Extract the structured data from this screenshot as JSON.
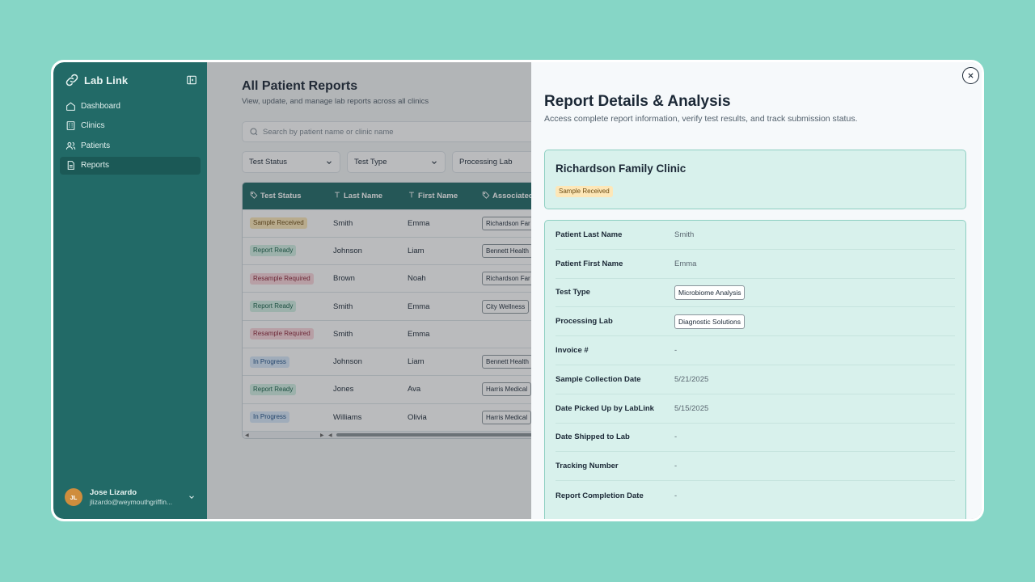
{
  "colors": {
    "brand": "#226a67",
    "background": "#86d6c6",
    "card": "#d8f1ec"
  },
  "sidebar": {
    "app_name": "Lab Link",
    "nav": [
      {
        "label": "Dashboard",
        "icon": "home-icon"
      },
      {
        "label": "Clinics",
        "icon": "building-icon"
      },
      {
        "label": "Patients",
        "icon": "users-icon"
      },
      {
        "label": "Reports",
        "icon": "document-icon",
        "active": true
      }
    ],
    "user": {
      "initials": "JL",
      "name": "Jose Lizardo",
      "email": "jlizardo@weymouthgriffin..."
    }
  },
  "main": {
    "title": "All Patient Reports",
    "subtitle": "View, update, and manage lab reports across all clinics",
    "search_placeholder": "Search by patient name or clinic name",
    "filters": [
      "Test Status",
      "Test Type",
      "Processing Lab"
    ],
    "columns": [
      "Test Status",
      "Last Name",
      "First Name",
      "Associated"
    ],
    "rows": [
      {
        "status": "Sample Received",
        "status_kind": "received",
        "last": "Smith",
        "first": "Emma",
        "clinic": "Richardson Far"
      },
      {
        "status": "Report Ready",
        "status_kind": "ready",
        "last": "Johnson",
        "first": "Liam",
        "clinic": "Bennett Health"
      },
      {
        "status": "Resample Required",
        "status_kind": "resample",
        "last": "Brown",
        "first": "Noah",
        "clinic": "Richardson Far"
      },
      {
        "status": "Report Ready",
        "status_kind": "ready",
        "last": "Smith",
        "first": "Emma",
        "clinic": "City Wellness"
      },
      {
        "status": "Resample Required",
        "status_kind": "resample",
        "last": "Smith",
        "first": "Emma",
        "clinic": ""
      },
      {
        "status": "In Progress",
        "status_kind": "progress",
        "last": "Johnson",
        "first": "Liam",
        "clinic": "Bennett Health"
      },
      {
        "status": "Report Ready",
        "status_kind": "ready",
        "last": "Jones",
        "first": "Ava",
        "clinic": "Harris Medical"
      },
      {
        "status": "In Progress",
        "status_kind": "progress",
        "last": "Williams",
        "first": "Olivia",
        "clinic": "Harris Medical"
      }
    ]
  },
  "drawer": {
    "title": "Report Details & Analysis",
    "subtitle": "Access complete report information, verify test results, and track submission status.",
    "clinic_name": "Richardson Family Clinic",
    "clinic_status": "Sample Received",
    "details": [
      {
        "label": "Patient Last Name",
        "value": "Smith",
        "chip": false
      },
      {
        "label": "Patient First Name",
        "value": "Emma",
        "chip": false
      },
      {
        "label": "Test Type",
        "value": "Microbiome Analysis",
        "chip": true
      },
      {
        "label": "Processing Lab",
        "value": "Diagnostic Solutions",
        "chip": true
      },
      {
        "label": "Invoice #",
        "value": "-",
        "chip": false
      },
      {
        "label": "Sample Collection Date",
        "value": "5/21/2025",
        "chip": false
      },
      {
        "label": "Date Picked Up by LabLink",
        "value": "5/15/2025",
        "chip": false
      },
      {
        "label": "Date Shipped to Lab",
        "value": "-",
        "chip": false
      },
      {
        "label": "Tracking Number",
        "value": "-",
        "chip": false
      },
      {
        "label": "Report Completion Date",
        "value": "-",
        "chip": false
      }
    ]
  }
}
